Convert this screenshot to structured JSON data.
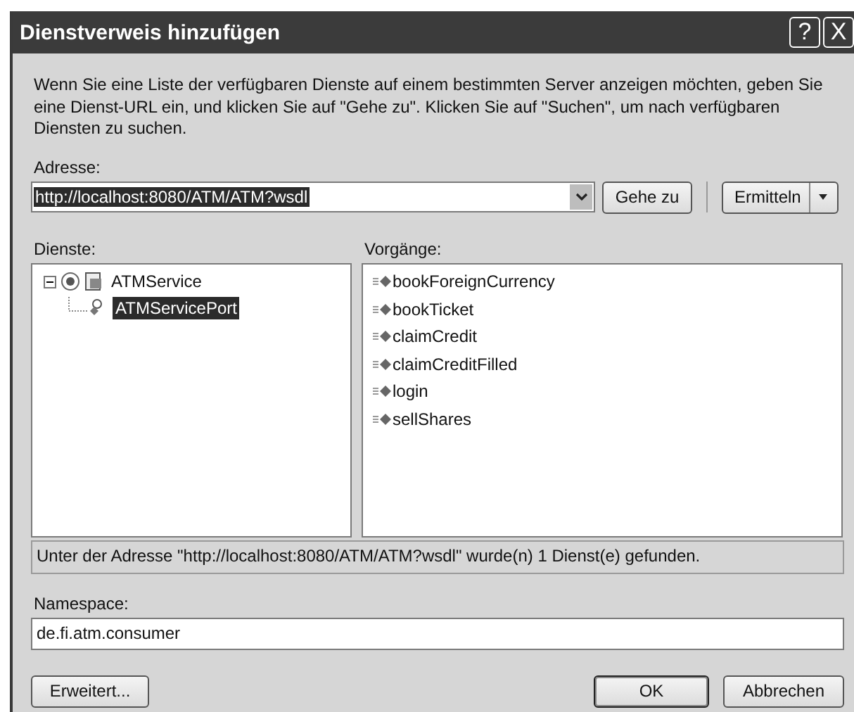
{
  "window": {
    "title": "Dienstverweis hinzufügen",
    "help": "?",
    "close": "X"
  },
  "intro": "Wenn Sie eine Liste der verfügbaren Dienste auf einem bestimmten Server anzeigen möchten, geben Sie eine Dienst-URL ein, und klicken Sie auf \"Gehe zu\". Klicken Sie auf \"Suchen\", um nach verfügbaren Diensten zu suchen.",
  "address": {
    "label": "Adresse:",
    "value": "http://localhost:8080/ATM/ATM?wsdl",
    "selected": true
  },
  "address_buttons": [
    {
      "label": "Gehe zu",
      "kind": "button"
    },
    {
      "label": "Ermitteln",
      "kind": "split"
    }
  ],
  "services": {
    "label": "Dienste:",
    "tree": [
      {
        "label": "ATMService",
        "expanded": true,
        "selected": false,
        "children": [
          {
            "label": "ATMServicePort",
            "selected": true
          }
        ]
      }
    ]
  },
  "operations": {
    "label": "Vorgänge:",
    "items": [
      "bookForeignCurrency",
      "bookTicket",
      "claimCredit",
      "claimCreditFilled",
      "login",
      "sellShares"
    ]
  },
  "status": "Unter der Adresse \"http://localhost:8080/ATM/ATM?wsdl\" wurde(n) 1 Dienst(e) gefunden.",
  "namespace": {
    "label": "Namespace:",
    "value": "de.fi.atm.consumer"
  },
  "buttons": [
    {
      "label": "Erweitert...",
      "default": false
    },
    {
      "label": "OK",
      "default": true
    },
    {
      "label": "Abbrechen",
      "default": false
    }
  ]
}
